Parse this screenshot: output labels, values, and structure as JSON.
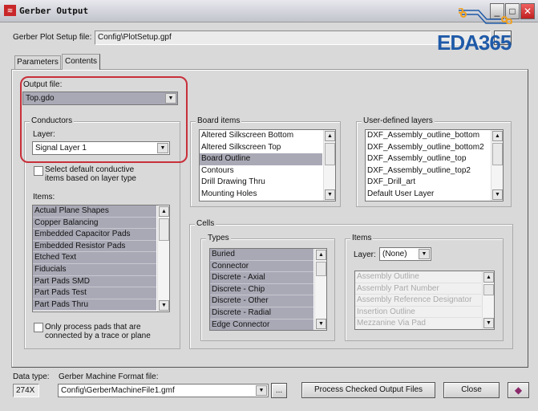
{
  "window": {
    "title": "Gerber Output",
    "minimize": "_",
    "maximize": "□",
    "close": "✕"
  },
  "plot_setup": {
    "label": "Gerber Plot Setup file:",
    "value": "Config\\PlotSetup.gpf"
  },
  "tabs": [
    {
      "label": "Parameters"
    },
    {
      "label": "Contents",
      "active": true
    }
  ],
  "output_file": {
    "label": "Output file:",
    "value": "Top.gdo"
  },
  "conductors": {
    "title": "Conductors",
    "layer_label": "Layer:",
    "layer_value": "Signal Layer 1",
    "select_default_label": "Select default conductive items based on layer type",
    "select_default_checked": false,
    "items_label": "Items:",
    "items": [
      "Actual Plane Shapes",
      "Copper Balancing",
      "Embedded Capacitor Pads",
      "Embedded Resistor Pads",
      "Etched Text",
      "Fiducials",
      "Part Pads SMD",
      "Part Pads Test",
      "Part Pads Thru"
    ],
    "only_process_label": "Only process pads that are connected by a trace or plane",
    "only_process_checked": false
  },
  "board_items": {
    "title": "Board items",
    "items": [
      "Altered Silkscreen Bottom",
      "Altered Silkscreen Top",
      "Board Outline",
      "Contours",
      "Drill Drawing Thru",
      "Mounting Holes"
    ],
    "selected": "Board Outline"
  },
  "user_layers": {
    "title": "User-defined layers",
    "items": [
      "DXF_Assembly_outline_bottom",
      "DXF_Assembly_outline_bottom2",
      "DXF_Assembly_outline_top",
      "DXF_Assembly_outline_top2",
      "DXF_Drill_art",
      "Default User Layer"
    ]
  },
  "cells": {
    "title": "Cells",
    "types_title": "Types",
    "types": [
      "Buried",
      "Connector",
      "Discrete - Axial",
      "Discrete - Chip",
      "Discrete - Other",
      "Discrete - Radial",
      "Edge Connector"
    ],
    "items_title": "Items",
    "layer_label": "Layer:",
    "layer_value": "(None)",
    "items": [
      "Assembly Outline",
      "Assembly Part Number",
      "Assembly Reference Designator",
      "Insertion Outline",
      "Mezzanine Via Pad"
    ]
  },
  "bottom": {
    "data_type_label": "Data type:",
    "data_type_value": "274X",
    "machine_label": "Gerber Machine Format file:",
    "machine_value": "Config\\GerberMachineFile1.gmf",
    "browse": "...",
    "process": "Process Checked Output Files",
    "close": "Close"
  },
  "watermark": "EDA365",
  "colors": {
    "highlight_ring": "#c8303a",
    "watermark": "#1f5aa8"
  }
}
